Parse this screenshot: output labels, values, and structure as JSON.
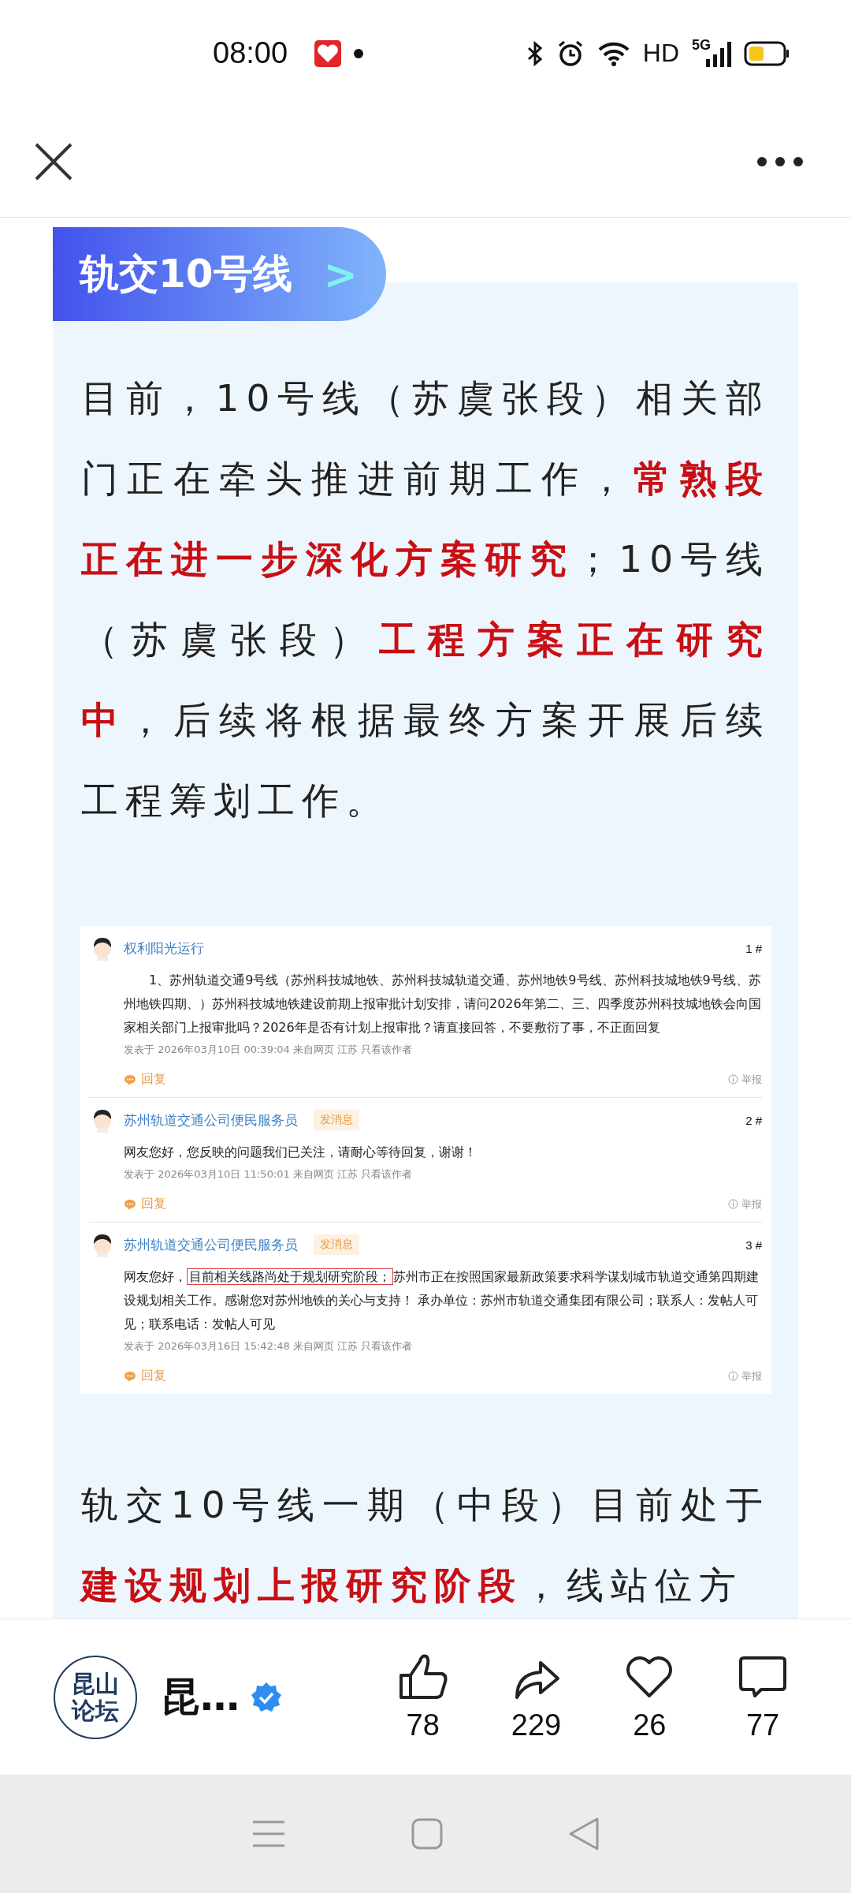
{
  "status_bar": {
    "time": "08:00",
    "network_labels": [
      "HD",
      "5G"
    ]
  },
  "article": {
    "tag": {
      "label": "轨交10号线",
      "arrow": ">"
    },
    "paragraphs": [
      "目前，10号线（苏虞张段）相关部门正在牵头推进前期工作，**常熟段正在进一步深化方案研究**；10号线（苏虞张段）**工程方案正在研究中**，后续将根据最终方案开展后续工程筹划工作。"
    ],
    "forum_screenshot": {
      "posts": [
        {
          "author": "权利阳光运行",
          "floor": "1 #",
          "indent": true,
          "body": [
            {
              "kind": "plain",
              "text": "1、苏州轨道交通9号线（苏州科技城地铁、苏州科技城轨道交通、苏州地铁9号线、苏州科技城地铁9号线、苏州地铁四期、）苏州科技城地铁建设前期上报审批计划安排，请问2026年第二、三、四季度苏州科技城地铁会向国家相关部门上报审批吗？2026年是否有计划上报审批？请直接回答，不要敷衍了事，不正面回复"
            }
          ],
          "meta": "发表于 2026年03月10日 00:39:04 来自网页 江苏 只看该作者",
          "reply": "回复",
          "report": "举报"
        },
        {
          "author": "苏州轨道交通公司便民服务员",
          "badge": "发消息",
          "floor": "2 #",
          "indent": false,
          "body": [
            {
              "kind": "plain",
              "text": "网友您好，您反映的问题我们已关注，请耐心等待回复，谢谢！"
            }
          ],
          "meta": "发表于 2026年03月10日 11:50:01 来自网页 江苏 只看该作者",
          "reply": "回复",
          "report": "举报"
        },
        {
          "author": "苏州轨道交通公司便民服务员",
          "badge": "发消息",
          "floor": "3 #",
          "indent": false,
          "body": [
            {
              "kind": "plain",
              "text": "网友您好，"
            },
            {
              "kind": "boxed",
              "text": "目前相关线路尚处于规划研究阶段；"
            },
            {
              "kind": "plain",
              "text": "苏州市正在按照国家最新政策要求科学谋划城市轨道交通第四期建设规划相关工作。感谢您对苏州地铁的关心与支持！ 承办单位：苏州市轨道交通集团有限公司；联系人：发帖人可见；联系电话：发帖人可见"
            }
          ],
          "meta": "发表于 2026年03月16日 15:42:48 来自网页 江苏 只看该作者",
          "reply": "回复",
          "report": "举报"
        }
      ]
    },
    "paragraphs_after": [
      "轨交10号线一期（中段）目前处于**建设规划上报研究阶段**，线站位方"
    ]
  },
  "bottom_bar": {
    "account": {
      "avatar_text": "昆山论坛",
      "name": "昆…",
      "verified": true
    },
    "actions": [
      {
        "kind": "like",
        "count": "78"
      },
      {
        "kind": "share",
        "count": "229"
      },
      {
        "kind": "favorite",
        "count": "26"
      },
      {
        "kind": "comment",
        "count": "77"
      }
    ]
  }
}
